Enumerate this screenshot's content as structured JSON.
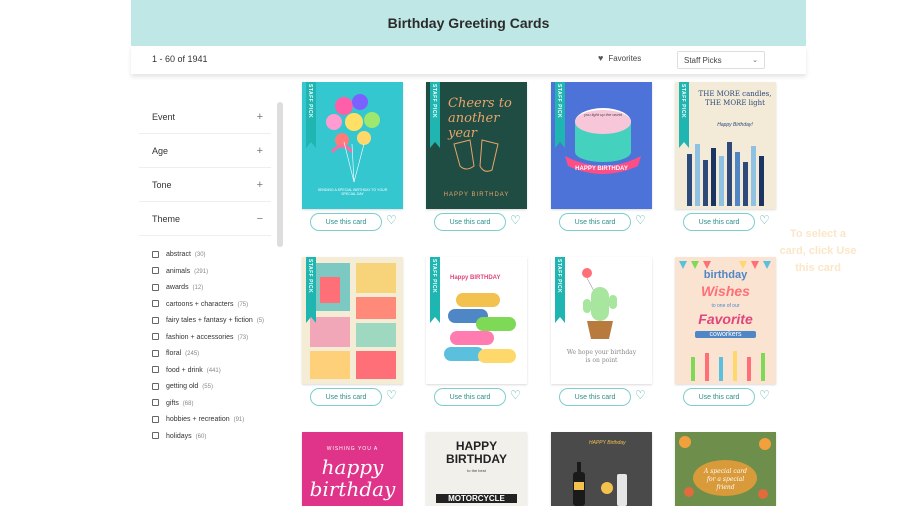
{
  "header": {
    "title": "Birthday Greeting Cards"
  },
  "toolbar": {
    "results": "1 - 60 of 1941",
    "favorites_label": "Favorites",
    "sort_value": "Staff Picks"
  },
  "colors": {
    "banner": "#bfe7e6",
    "accent": "#1fb5b0",
    "button_border": "#7ccfcc"
  },
  "sidebar": {
    "facets": [
      {
        "label": "Event",
        "sign": "+"
      },
      {
        "label": "Age",
        "sign": "+"
      },
      {
        "label": "Tone",
        "sign": "+"
      },
      {
        "label": "Theme",
        "sign": "−"
      }
    ],
    "themes": [
      {
        "name": "abstract",
        "count": "(30)"
      },
      {
        "name": "animals",
        "count": "(291)"
      },
      {
        "name": "awards",
        "count": "(12)"
      },
      {
        "name": "cartoons + characters",
        "count": "(75)"
      },
      {
        "name": "fairy tales + fantasy + fiction",
        "count": "(5)"
      },
      {
        "name": "fashion + accessories",
        "count": "(73)"
      },
      {
        "name": "floral",
        "count": "(245)"
      },
      {
        "name": "food + drink",
        "count": "(441)"
      },
      {
        "name": "getting old",
        "count": "(55)"
      },
      {
        "name": "gifts",
        "count": "(68)"
      },
      {
        "name": "hobbies + recreation",
        "count": "(91)"
      },
      {
        "name": "holidays",
        "count": "(60)"
      }
    ]
  },
  "cards": {
    "use_label": "Use this card",
    "ribbon_label": "STAFF PICK",
    "c1": {
      "tiny": "SENDING A SPECIAL BIRTHDAY TO YOUR SPECIAL DAY"
    },
    "c2": {
      "script": "Cheers to another year",
      "caption": "HAPPY BIRTHDAY"
    },
    "c3": {
      "script": "you light up the world",
      "banner": "HAPPY BIRTHDAY"
    },
    "c4": {
      "line1": "THE MORE candles, THE MORE light",
      "line2": "Happy Birthday!"
    },
    "c6": {
      "top": "Happy BIRTHDAY"
    },
    "c7": {
      "text": "We hope your birthday is on point"
    },
    "c8": {
      "w1": "birthday",
      "w2": "Wishes",
      "w3": "to one of our",
      "w4": "Favorite",
      "w5": "coworkers"
    },
    "c9": {
      "top": "WISHING YOU A",
      "big": "happy birthday"
    },
    "c10": {
      "big": "HAPPY BIRTHDAY",
      "small": "to the best",
      "plate": "MOTORCYCLE"
    },
    "c11": {
      "text": "HAPPY Birthday"
    },
    "c12": {
      "text": "A special card for a special friend"
    }
  },
  "overlay": {
    "text": "To select a card, click Use this card"
  }
}
